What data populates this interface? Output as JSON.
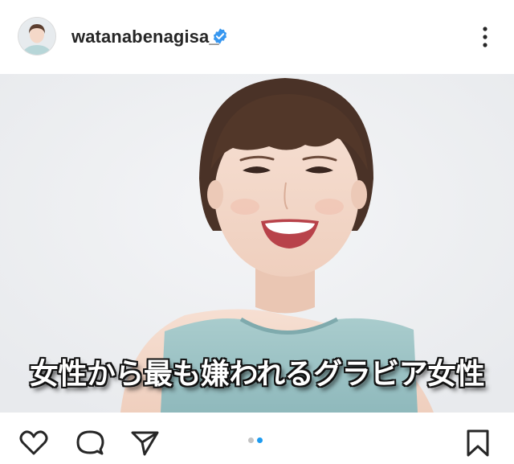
{
  "post": {
    "username": "watanabenagisa_",
    "verified": true,
    "avatar_icon": "profile-avatar",
    "more_icon": "more-vertical-icon",
    "image_caption": "女性から最も嫌われるグラビア女性",
    "carousel": {
      "total": 2,
      "active_index": 1
    }
  },
  "actions": {
    "like_icon": "heart-icon",
    "comment_icon": "comment-icon",
    "share_icon": "paper-plane-icon",
    "save_icon": "bookmark-icon"
  },
  "colors": {
    "verified_blue": "#3797f0",
    "carousel_active": "#1d9bf0",
    "carousel_inactive": "#c4c4c4",
    "top_color": "#9bc0c3"
  }
}
